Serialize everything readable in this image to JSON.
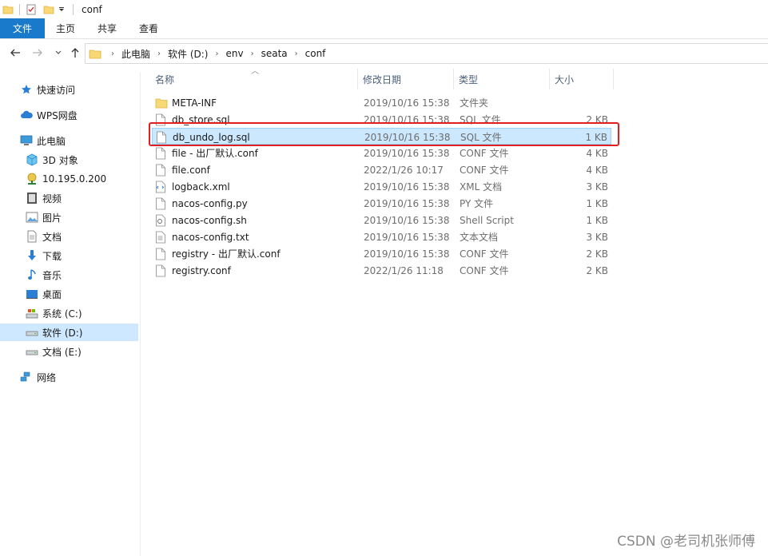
{
  "window": {
    "title": "conf"
  },
  "ribbon": {
    "tabs": [
      "文件",
      "主页",
      "共享",
      "查看"
    ]
  },
  "address": {
    "crumbs": [
      "此电脑",
      "软件 (D:)",
      "env",
      "seata",
      "conf"
    ]
  },
  "nav": {
    "items": [
      {
        "label": "快速访问",
        "icon": "star-icon"
      },
      {
        "label": "WPS网盘",
        "icon": "cloud-icon"
      },
      {
        "label": "此电脑",
        "icon": "computer-icon"
      },
      {
        "label": "3D 对象",
        "icon": "cube-icon"
      },
      {
        "label": "10.195.0.200",
        "icon": "network-drive-icon"
      },
      {
        "label": "视频",
        "icon": "video-icon"
      },
      {
        "label": "图片",
        "icon": "picture-icon"
      },
      {
        "label": "文档",
        "icon": "document-icon"
      },
      {
        "label": "下载",
        "icon": "download-icon"
      },
      {
        "label": "音乐",
        "icon": "music-icon"
      },
      {
        "label": "桌面",
        "icon": "desktop-icon"
      },
      {
        "label": "系统 (C:)",
        "icon": "drive-icon"
      },
      {
        "label": "软件 (D:)",
        "icon": "drive-icon",
        "selected": true
      },
      {
        "label": "文档 (E:)",
        "icon": "drive-icon"
      },
      {
        "label": "网络",
        "icon": "network-icon"
      }
    ]
  },
  "columns": {
    "name": "名称",
    "date": "修改日期",
    "type": "类型",
    "size": "大小"
  },
  "files": [
    {
      "name": "META-INF",
      "date": "2019/10/16 15:38",
      "type": "文件夹",
      "size": "",
      "icon": "folder-icon"
    },
    {
      "name": "db_store.sql",
      "date": "2019/10/16 15:38",
      "type": "SQL 文件",
      "size": "2 KB",
      "icon": "file-icon"
    },
    {
      "name": "db_undo_log.sql",
      "date": "2019/10/16 15:38",
      "type": "SQL 文件",
      "size": "1 KB",
      "icon": "file-icon",
      "selected": true
    },
    {
      "name": "file - 出厂默认.conf",
      "date": "2019/10/16 15:38",
      "type": "CONF 文件",
      "size": "4 KB",
      "icon": "file-icon"
    },
    {
      "name": "file.conf",
      "date": "2022/1/26 10:17",
      "type": "CONF 文件",
      "size": "4 KB",
      "icon": "file-icon"
    },
    {
      "name": "logback.xml",
      "date": "2019/10/16 15:38",
      "type": "XML 文档",
      "size": "3 KB",
      "icon": "xml-file-icon"
    },
    {
      "name": "nacos-config.py",
      "date": "2019/10/16 15:38",
      "type": "PY 文件",
      "size": "1 KB",
      "icon": "file-icon"
    },
    {
      "name": "nacos-config.sh",
      "date": "2019/10/16 15:38",
      "type": "Shell Script",
      "size": "1 KB",
      "icon": "script-file-icon"
    },
    {
      "name": "nacos-config.txt",
      "date": "2019/10/16 15:38",
      "type": "文本文档",
      "size": "3 KB",
      "icon": "text-file-icon"
    },
    {
      "name": "registry - 出厂默认.conf",
      "date": "2019/10/16 15:38",
      "type": "CONF 文件",
      "size": "2 KB",
      "icon": "file-icon"
    },
    {
      "name": "registry.conf",
      "date": "2022/1/26 11:18",
      "type": "CONF 文件",
      "size": "2 KB",
      "icon": "file-icon"
    }
  ],
  "watermark": "CSDN @老司机张师傅",
  "colors": {
    "accent": "#1979ca",
    "selection": "#cce8ff",
    "highlight_box": "#e02020"
  }
}
